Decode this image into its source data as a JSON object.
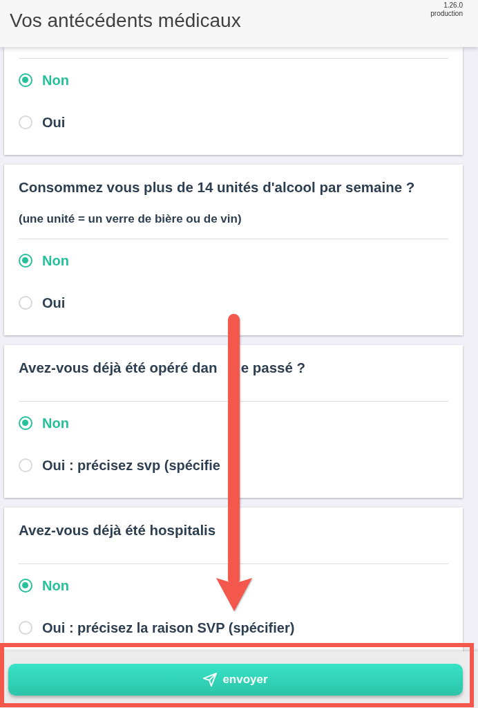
{
  "header": {
    "title": "Vos antécédents médicaux",
    "version": "1.26.0",
    "environment": "production"
  },
  "questions": [
    {
      "options": [
        {
          "label": "Non",
          "selected": true
        },
        {
          "label": "Oui",
          "selected": false
        }
      ]
    },
    {
      "question": "Consommez vous plus de 14 unités d'alcool par semaine ?",
      "note": "(une unité = un verre de bière ou de vin)",
      "options": [
        {
          "label": "Non",
          "selected": true
        },
        {
          "label": "Oui",
          "selected": false
        }
      ]
    },
    {
      "question": "Avez-vous déjà été opéré dan",
      "question_tail": "e passé ?",
      "options": [
        {
          "label": "Non",
          "selected": true
        },
        {
          "label": "Oui : précisez svp (spécifie",
          "selected": false
        }
      ]
    },
    {
      "question": "Avez-vous déjà été hospitalis",
      "options": [
        {
          "label": "Non",
          "selected": true
        },
        {
          "label": "Oui : précisez la raison SVP (spécifier)",
          "selected": false
        }
      ]
    }
  ],
  "submit_button": {
    "label": "envoyer"
  }
}
